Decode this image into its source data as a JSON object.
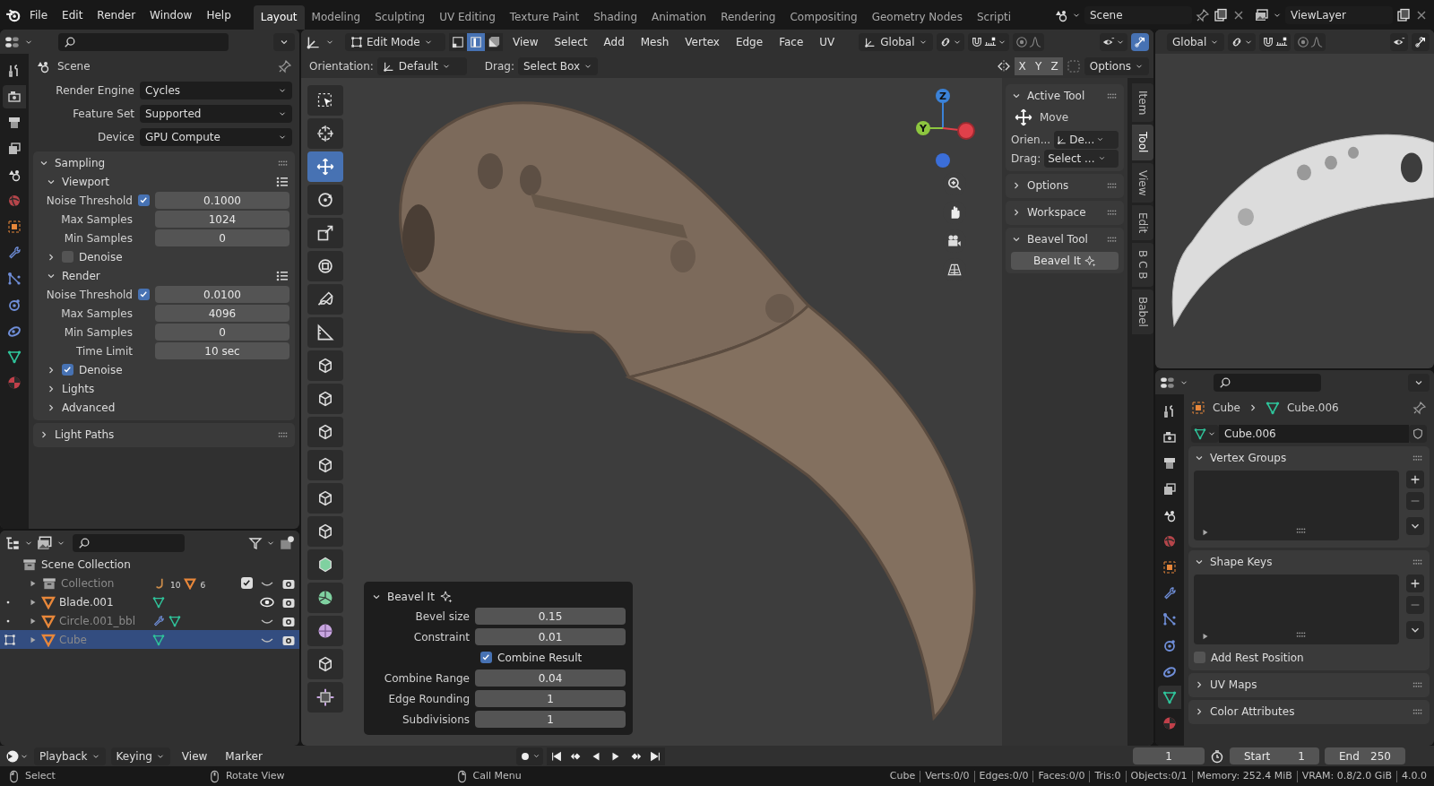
{
  "topbar": {
    "menus": [
      "File",
      "Edit",
      "Render",
      "Window",
      "Help"
    ],
    "workspaces": [
      {
        "label": "Layout",
        "selected": true
      },
      {
        "label": "Modeling",
        "selected": false
      },
      {
        "label": "Sculpting",
        "selected": false
      },
      {
        "label": "UV Editing",
        "selected": false
      },
      {
        "label": "Texture Paint",
        "selected": false
      },
      {
        "label": "Shading",
        "selected": false
      },
      {
        "label": "Animation",
        "selected": false
      },
      {
        "label": "Rendering",
        "selected": false
      },
      {
        "label": "Compositing",
        "selected": false
      },
      {
        "label": "Geometry Nodes",
        "selected": false
      },
      {
        "label": "Scripti",
        "selected": false
      }
    ],
    "scene": "Scene",
    "view_layer": "ViewLayer"
  },
  "properties_left": {
    "tabs": [
      {
        "selected": false
      },
      {
        "selected": true
      },
      {
        "selected": false
      },
      {
        "selected": false
      },
      {
        "selected": false
      },
      {
        "selected": false
      },
      {
        "selected": false
      },
      {
        "selected": false
      },
      {
        "selected": false
      },
      {
        "selected": false
      },
      {
        "selected": false
      },
      {
        "selected": false
      },
      {
        "selected": false
      }
    ],
    "context": "Scene",
    "fields": [
      {
        "label": "Render Engine",
        "value": "Cycles"
      },
      {
        "label": "Feature Set",
        "value": "Supported"
      },
      {
        "label": "Device",
        "value": "GPU Compute"
      }
    ],
    "panels": [
      {
        "kind": "panel",
        "title": "Sampling",
        "expanded": true,
        "children": [
          {
            "kind": "subpanel",
            "title": "Viewport",
            "expanded": true,
            "children": [
              {
                "kind": "check_number",
                "label": "Noise Threshold",
                "checked": true,
                "value": "0.1000"
              },
              {
                "kind": "number",
                "label": "Max Samples",
                "value": "1024"
              },
              {
                "kind": "number",
                "label": "Min Samples",
                "value": "0"
              },
              {
                "kind": "check_panel",
                "label": "Denoise",
                "checked": false,
                "expanded": false
              }
            ]
          },
          {
            "kind": "subpanel",
            "title": "Render",
            "expanded": true,
            "children": [
              {
                "kind": "check_number",
                "label": "Noise Threshold",
                "checked": true,
                "value": "0.0100"
              },
              {
                "kind": "number",
                "label": "Max Samples",
                "value": "4096"
              },
              {
                "kind": "number",
                "label": "Min Samples",
                "value": "0"
              },
              {
                "kind": "number",
                "label": "Time Limit",
                "value": "10 sec"
              },
              {
                "kind": "check_panel",
                "label": "Denoise",
                "checked": true,
                "expanded": false
              }
            ]
          },
          {
            "kind": "subpanel",
            "title": "Lights",
            "expanded": false
          },
          {
            "kind": "subpanel",
            "title": "Advanced",
            "expanded": false
          }
        ]
      },
      {
        "kind": "panel",
        "title": "Light Paths",
        "expanded": false
      }
    ]
  },
  "outliner": {
    "items": [
      {
        "kind": "scene_collection",
        "label": "Scene Collection",
        "selected": false,
        "dimmed": false,
        "children": [
          {
            "kind": "collection",
            "label": "Collection",
            "selected": false,
            "dimmed": true,
            "checked": true,
            "visible": false,
            "counts": [
              {
                "kind": "curve",
                "count": "10"
              },
              {
                "kind": "mesh",
                "count": "6"
              }
            ]
          },
          {
            "kind": "object",
            "label": "Blade.001",
            "selected": false,
            "dimmed": false,
            "edit_mode": false,
            "modifier": false,
            "visible": true
          },
          {
            "kind": "object",
            "label": "Circle.001_bbl",
            "selected": false,
            "dimmed": true,
            "edit_mode": false,
            "modifier": true,
            "visible": false
          },
          {
            "kind": "object",
            "label": "Cube",
            "selected": true,
            "dimmed": true,
            "edit_mode": true,
            "modifier": false,
            "visible": false
          }
        ]
      }
    ]
  },
  "viewport": {
    "mode": "Edit Mode",
    "select_modes": [
      {
        "selected": false
      },
      {
        "selected": true
      },
      {
        "selected": false
      }
    ],
    "menus": [
      "View",
      "Select",
      "Add",
      "Mesh",
      "Vertex",
      "Edge",
      "Face",
      "UV"
    ],
    "orientation": "Global",
    "tool_settings": {
      "orientation_label": "Orientation:",
      "orientation": "Default",
      "drag_label": "Drag:",
      "drag": "Select Box",
      "axes": [
        "X",
        "Y",
        "Z"
      ],
      "options": "Options"
    },
    "tools": [
      {
        "selected": false
      },
      {
        "selected": false
      },
      {
        "selected": true
      },
      {
        "selected": false
      },
      {
        "selected": false
      },
      {
        "selected": false
      },
      {
        "selected": false
      },
      {
        "selected": false
      },
      {
        "selected": false
      },
      {
        "selected": false
      },
      {
        "selected": false
      },
      {
        "selected": false
      },
      {
        "selected": false
      },
      {
        "selected": false
      },
      {
        "selected": false
      },
      {
        "selected": false
      },
      {
        "selected": false
      },
      {
        "selected": false
      },
      {
        "selected": false
      }
    ],
    "gizmo_axes": [
      "Z",
      "Y"
    ],
    "sidebar": {
      "active_tool_title": "Active Tool",
      "tool_name": "Move",
      "orientation_label": "Orien...",
      "orientation": "De...",
      "drag_label": "Drag:",
      "drag": "Select ...",
      "panels": [
        {
          "title": "Options",
          "expanded": false
        },
        {
          "title": "Workspace",
          "expanded": false
        },
        {
          "title": "Beavel Tool",
          "expanded": true
        }
      ],
      "button": "Beavel It",
      "tabs": [
        {
          "label": "Item",
          "selected": false
        },
        {
          "label": "Tool",
          "selected": true
        },
        {
          "label": "View",
          "selected": false
        },
        {
          "label": "Edit",
          "selected": false
        },
        {
          "label": "B C B",
          "selected": false
        },
        {
          "label": "Babel",
          "selected": false
        }
      ]
    },
    "redo_panel": {
      "title": "Beavel It",
      "expanded": true,
      "rows": [
        {
          "kind": "number",
          "label": "Bevel size",
          "value": "0.15"
        },
        {
          "kind": "number",
          "label": "Constraint",
          "value": "0.01"
        },
        {
          "kind": "checkbox",
          "label": "Combine Result",
          "checked": true
        },
        {
          "kind": "number",
          "label": "Combine Range",
          "value": "0.04"
        },
        {
          "kind": "number",
          "label": "Edge Rounding",
          "value": "1"
        },
        {
          "kind": "number",
          "label": "Subdivisions",
          "value": "1"
        }
      ]
    }
  },
  "preview_viewport": {
    "orientation": "Global"
  },
  "properties_right": {
    "tabs": [
      {
        "selected": false
      },
      {
        "selected": false
      },
      {
        "selected": false
      },
      {
        "selected": false
      },
      {
        "selected": false
      },
      {
        "selected": false
      },
      {
        "selected": false
      },
      {
        "selected": false
      },
      {
        "selected": false
      },
      {
        "selected": false
      },
      {
        "selected": false
      },
      {
        "selected": true
      },
      {
        "selected": false
      }
    ],
    "breadcrumb": [
      "Cube",
      "Cube.006"
    ],
    "datablock": "Cube.006",
    "panels": [
      {
        "title": "Vertex Groups",
        "expanded": true,
        "kind": "list"
      },
      {
        "title": "Shape Keys",
        "expanded": true,
        "kind": "list_check",
        "check_label": "Add Rest Position",
        "checked": false
      },
      {
        "title": "UV Maps",
        "expanded": false
      },
      {
        "title": "Color Attributes",
        "expanded": false
      }
    ]
  },
  "timeline": {
    "menus": [
      {
        "label": "Playback",
        "dropdown": true
      },
      {
        "label": "Keying",
        "dropdown": true
      },
      {
        "label": "View",
        "dropdown": false
      },
      {
        "label": "Marker",
        "dropdown": false
      }
    ],
    "current_frame": "1",
    "start_label": "Start",
    "start": "1",
    "end_label": "End",
    "end": "250"
  },
  "status_bar": {
    "hints": [
      "Select",
      "Rotate View",
      "Call Menu"
    ],
    "stats": [
      "Cube",
      "Verts:0/0",
      "Edges:0/0",
      "Faces:0/0",
      "Tris:0",
      "Objects:0/1",
      "Memory: 252.4 MiB",
      "VRAM: 0.8/2.0 GiB",
      "4.0.0"
    ]
  }
}
